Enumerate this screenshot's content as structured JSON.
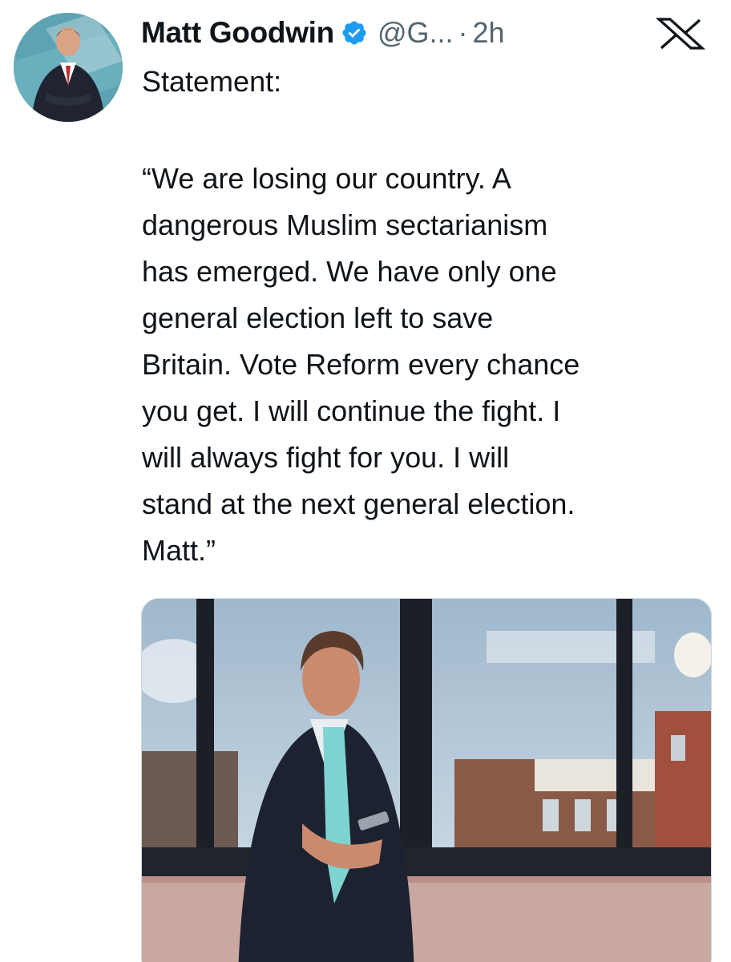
{
  "post": {
    "author_name": "Matt Goodwin",
    "handle": "@G...",
    "separator": "·",
    "time": "2h",
    "title_line": "Statement:",
    "body_lines": [
      "“We are losing our country. A",
      "dangerous Muslim sectarianism",
      "has emerged. We have only one",
      "general election left to save",
      "Britain. Vote Reform every chance",
      "you get. I will continue the fight. I",
      "will always fight for you. I will",
      "stand at the next general election.",
      "Matt.”"
    ]
  },
  "icons": {
    "verified": "verified-badge-icon",
    "platform": "x-logo-icon"
  },
  "colors": {
    "verified_blue": "#1d9bf0",
    "secondary_text": "#536471",
    "primary_text": "#0f1419"
  }
}
